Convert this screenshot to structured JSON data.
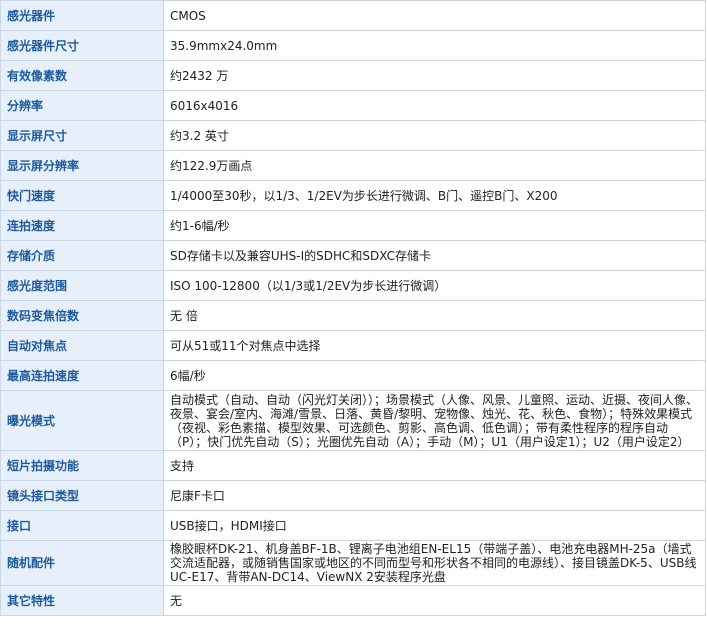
{
  "specs": [
    {
      "label": "感光器件",
      "value": "CMOS"
    },
    {
      "label": "感光器件尺寸",
      "value": "35.9mmx24.0mm"
    },
    {
      "label": "有效像素数",
      "value": "约2432  万"
    },
    {
      "label": "分辨率",
      "value": "6016x4016"
    },
    {
      "label": "显示屏尺寸",
      "value": "约3.2  英寸"
    },
    {
      "label": "显示屏分辨率",
      "value": "约122.9万画点"
    },
    {
      "label": "快门速度",
      "value": "1/4000至30秒，以1/3、1/2EV为步长进行微调、B门、遥控B门、X200"
    },
    {
      "label": "连拍速度",
      "value": "约1-6幅/秒"
    },
    {
      "label": "存储介质",
      "value": "SD存储卡以及兼容UHS-I的SDHC和SDXC存储卡"
    },
    {
      "label": "感光度范围",
      "value": "ISO 100-12800（以1/3或1/2EV为步长进行微调）"
    },
    {
      "label": "数码变焦倍数",
      "value": "无  倍"
    },
    {
      "label": "自动对焦点",
      "value": "可从51或11个对焦点中选择"
    },
    {
      "label": "最高连拍速度",
      "value": "6幅/秒"
    },
    {
      "label": "曝光模式",
      "value": "自动模式（自动、自动（闪光灯关闭））；场景模式（人像、风景、儿童照、运动、近摄、夜间人像、夜景、宴会/室内、海滩/雪景、日落、黄昏/黎明、宠物像、烛光、花、秋色、食物）；特殊效果模式（夜视、彩色素描、模型效果、可选颜色、剪影、高色调、低色调）；带有柔性程序的程序自动（P）；快门优先自动（S）；光圈优先自动（A）；手动（M）；U1（用户设定1）；U2（用户设定2）"
    },
    {
      "label": "短片拍摄功能",
      "value": "支持"
    },
    {
      "label": "镜头接口类型",
      "value": "尼康F卡口"
    },
    {
      "label": "接口",
      "value": "USB接口，HDMI接口"
    },
    {
      "label": "随机配件",
      "value": "橡胶眼杯DK-21、机身盖BF-1B、锂离子电池组EN-EL15（带端子盖）、电池充电器MH-25a（墙式交流适配器，或随销售国家或地区的不同而型号和形状各不相同的电源线）、接目镜盖DK-5、USB线UC-E17、背带AN-DC14、ViewNX 2安装程序光盘"
    },
    {
      "label": "其它特性",
      "value": "无"
    }
  ]
}
